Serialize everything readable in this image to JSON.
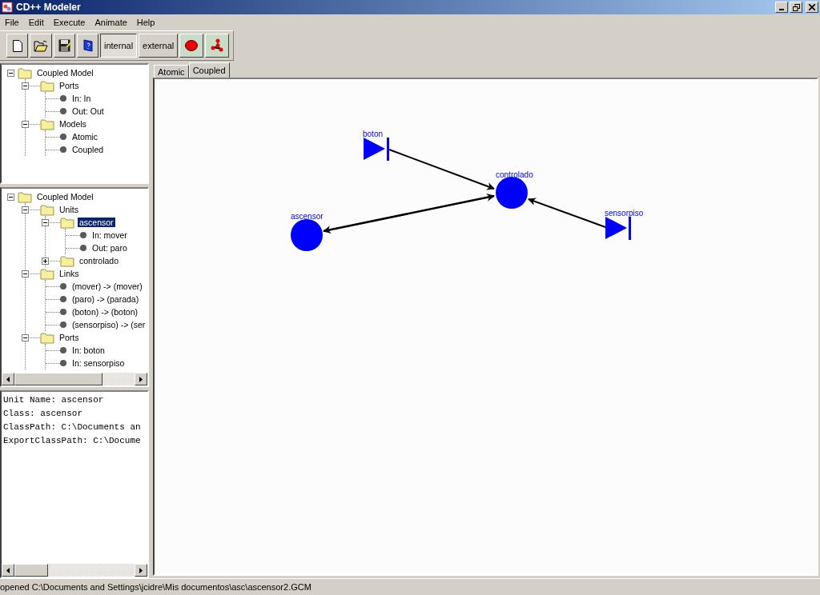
{
  "window": {
    "title": "CD++ Modeler"
  },
  "menu": [
    "File",
    "Edit",
    "Execute",
    "Animate",
    "Help"
  ],
  "toolbar": [
    {
      "kind": "new"
    },
    {
      "kind": "open"
    },
    {
      "kind": "save"
    },
    {
      "kind": "help"
    },
    {
      "kind": "text",
      "label": "internal",
      "selected": true
    },
    {
      "kind": "text",
      "label": "external",
      "selected": false
    },
    {
      "kind": "stop"
    },
    {
      "kind": "graph"
    }
  ],
  "model_tree": {
    "items": [
      {
        "kind": "folder",
        "label": "Coupled Model",
        "expanded": true,
        "selected": false,
        "children": [
          {
            "kind": "folder",
            "label": "Ports",
            "expanded": true,
            "selected": false,
            "children": [
              {
                "kind": "leaf",
                "label": "In: In",
                "selected": false
              },
              {
                "kind": "leaf",
                "label": "Out: Out",
                "selected": false
              }
            ]
          },
          {
            "kind": "folder",
            "label": "Models",
            "expanded": true,
            "selected": false,
            "children": [
              {
                "kind": "leaf",
                "label": "Atomic",
                "selected": false
              },
              {
                "kind": "leaf",
                "label": "Coupled",
                "selected": false
              }
            ]
          }
        ]
      }
    ]
  },
  "structure_tree": {
    "items": [
      {
        "kind": "folder",
        "label": "Coupled Model",
        "expanded": true,
        "selected": false,
        "children": [
          {
            "kind": "folder",
            "label": "Units",
            "expanded": true,
            "selected": false,
            "children": [
              {
                "kind": "folder",
                "label": "ascensor",
                "expanded": true,
                "selected": true,
                "children": [
                  {
                    "kind": "leaf",
                    "label": "In: mover",
                    "selected": false
                  },
                  {
                    "kind": "leaf",
                    "label": "Out: paro",
                    "selected": false
                  }
                ]
              },
              {
                "kind": "folder",
                "label": "controlado",
                "expanded": false,
                "selected": false
              }
            ]
          },
          {
            "kind": "folder",
            "label": "Links",
            "expanded": true,
            "selected": false,
            "children": [
              {
                "kind": "leaf",
                "label": "(mover) -> (mover)",
                "selected": false
              },
              {
                "kind": "leaf",
                "label": "(paro) -> (parada)",
                "selected": false
              },
              {
                "kind": "leaf",
                "label": "(boton) -> (boton)",
                "selected": false
              },
              {
                "kind": "leaf",
                "label": "(sensorpiso) -> (ser",
                "selected": false
              }
            ]
          },
          {
            "kind": "folder",
            "label": "Ports",
            "expanded": true,
            "selected": false,
            "children": [
              {
                "kind": "leaf",
                "label": "In: boton",
                "selected": false
              },
              {
                "kind": "leaf",
                "label": "In: sensorpiso",
                "selected": false
              }
            ]
          }
        ]
      }
    ]
  },
  "info": [
    "Unit Name: ascensor",
    "Class: ascensor",
    "ClassPath: C:\\Documents an",
    "ExportClassPath: C:\\Docume"
  ],
  "tabs": [
    {
      "label": "Atomic",
      "selected": false
    },
    {
      "label": "Coupled",
      "selected": true
    }
  ],
  "diagram": {
    "nodes": [
      {
        "kind": "port",
        "label": "boton"
      },
      {
        "kind": "model",
        "label": "controlado"
      },
      {
        "kind": "model",
        "label": "ascensor"
      },
      {
        "kind": "port",
        "label": "sensorpiso"
      }
    ]
  },
  "status_bar": "opened C:\\Documents and Settings\\jcidre\\Mis documentos\\asc\\ascensor2.GCM"
}
